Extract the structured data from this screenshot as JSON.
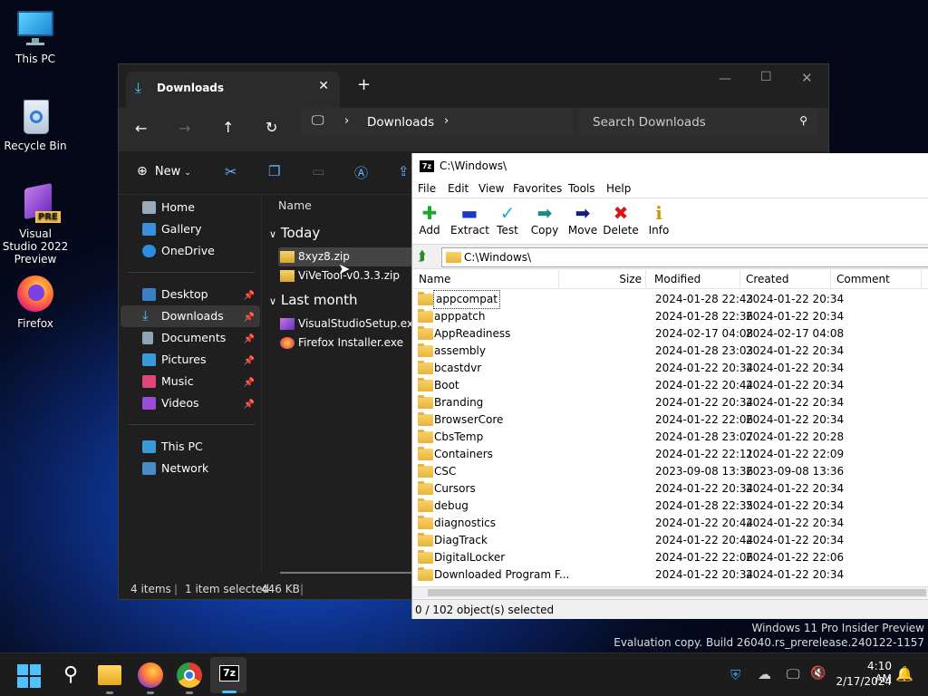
{
  "desktop": {
    "icons": [
      {
        "label": "This PC",
        "icon": "monitor-icon"
      },
      {
        "label": "Recycle Bin",
        "icon": "recycle-bin-icon"
      },
      {
        "label": "Visual Studio 2022 Preview",
        "badge": "PRE",
        "icon": "visual-studio-icon"
      },
      {
        "label": "Firefox",
        "icon": "firefox-icon"
      }
    ],
    "watermark": {
      "line1": "Windows 11 Pro Insider Preview",
      "line2": "Evaluation copy. Build 26040.rs_prerelease.240122-1157"
    }
  },
  "explorer": {
    "tab_title": "Downloads",
    "new_tab": "+",
    "breadcrumb": "Downloads",
    "search_placeholder": "Search Downloads",
    "new_label": "New",
    "column_name": "Name",
    "sidebar": {
      "top": [
        {
          "label": "Home"
        },
        {
          "label": "Gallery"
        },
        {
          "label": "OneDrive"
        }
      ],
      "pinned": [
        {
          "label": "Desktop"
        },
        {
          "label": "Downloads"
        },
        {
          "label": "Documents"
        },
        {
          "label": "Pictures"
        },
        {
          "label": "Music"
        },
        {
          "label": "Videos"
        }
      ],
      "bottom": [
        {
          "label": "This PC"
        },
        {
          "label": "Network"
        }
      ]
    },
    "groups": [
      {
        "label": "Today",
        "files": [
          "8xyz8.zip",
          "ViVeTool-v0.3.3.zip"
        ]
      },
      {
        "label": "Last month",
        "files": [
          "VisualStudioSetup.exe",
          "Firefox Installer.exe"
        ]
      }
    ],
    "status": {
      "items": "4 items",
      "selected": "1 item selected",
      "size": "446 KB",
      "sep": "|"
    }
  },
  "sevenzip": {
    "title": "C:\\Windows\\",
    "menu": [
      "File",
      "Edit",
      "View",
      "Favorites",
      "Tools",
      "Help"
    ],
    "toolbar": [
      "Add",
      "Extract",
      "Test",
      "Copy",
      "Move",
      "Delete",
      "Info"
    ],
    "address": "C:\\Windows\\",
    "columns": {
      "name": "Name",
      "size": "Size",
      "modified": "Modified",
      "created": "Created",
      "comment": "Comment"
    },
    "rows": [
      {
        "name": "appcompat",
        "modified": "2024-01-28 22:43",
        "created": "2024-01-22 20:34"
      },
      {
        "name": "apppatch",
        "modified": "2024-01-28 22:36",
        "created": "2024-01-22 20:34"
      },
      {
        "name": "AppReadiness",
        "modified": "2024-02-17 04:08",
        "created": "2024-02-17 04:08"
      },
      {
        "name": "assembly",
        "modified": "2024-01-28 23:03",
        "created": "2024-01-22 20:34"
      },
      {
        "name": "bcastdvr",
        "modified": "2024-01-22 20:34",
        "created": "2024-01-22 20:34"
      },
      {
        "name": "Boot",
        "modified": "2024-01-22 20:44",
        "created": "2024-01-22 20:34"
      },
      {
        "name": "Branding",
        "modified": "2024-01-22 20:34",
        "created": "2024-01-22 20:34"
      },
      {
        "name": "BrowserCore",
        "modified": "2024-01-22 22:06",
        "created": "2024-01-22 20:34"
      },
      {
        "name": "CbsTemp",
        "modified": "2024-01-28 23:07",
        "created": "2024-01-22 20:28"
      },
      {
        "name": "Containers",
        "modified": "2024-01-22 22:11",
        "created": "2024-01-22 22:09"
      },
      {
        "name": "CSC",
        "modified": "2023-09-08 13:36",
        "created": "2023-09-08 13:36"
      },
      {
        "name": "Cursors",
        "modified": "2024-01-22 20:34",
        "created": "2024-01-22 20:34"
      },
      {
        "name": "debug",
        "modified": "2024-01-28 22:35",
        "created": "2024-01-22 20:34"
      },
      {
        "name": "diagnostics",
        "modified": "2024-01-22 20:44",
        "created": "2024-01-22 20:34"
      },
      {
        "name": "DiagTrack",
        "modified": "2024-01-22 20:44",
        "created": "2024-01-22 20:34"
      },
      {
        "name": "DigitalLocker",
        "modified": "2024-01-22 22:06",
        "created": "2024-01-22 22:06"
      },
      {
        "name": "Downloaded Program F...",
        "modified": "2024-01-22 20:34",
        "created": "2024-01-22 20:34"
      }
    ],
    "status": "0 / 102 object(s) selected"
  },
  "taskbar": {
    "time": "4:10 AM",
    "date": "2/17/2024",
    "apps": [
      "start-icon",
      "search-icon",
      "file-explorer-icon",
      "firefox-icon",
      "chrome-icon",
      "7zip-icon"
    ]
  }
}
